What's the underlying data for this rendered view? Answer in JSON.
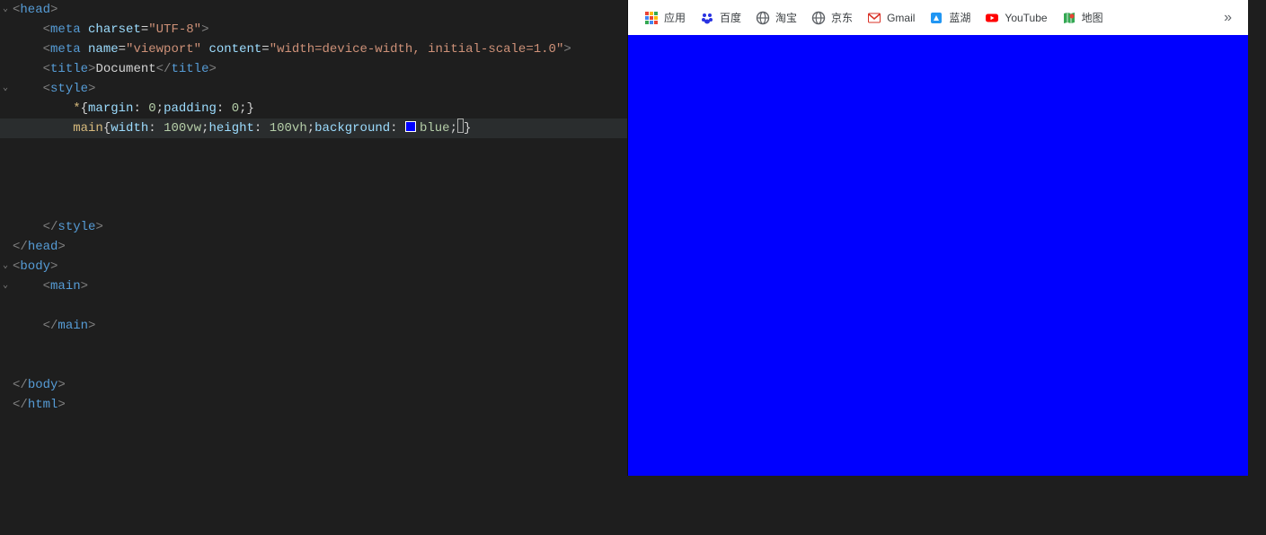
{
  "editor": {
    "lines": [
      {
        "indent": 0,
        "fold": true,
        "tokens": [
          {
            "c": "t-bracket",
            "t": "<"
          },
          {
            "c": "t-tag",
            "t": "head"
          },
          {
            "c": "t-bracket",
            "t": ">"
          }
        ]
      },
      {
        "indent": 1,
        "tokens": [
          {
            "c": "t-bracket",
            "t": "<"
          },
          {
            "c": "t-tag",
            "t": "meta"
          },
          {
            "c": "",
            "t": " "
          },
          {
            "c": "t-attr",
            "t": "charset"
          },
          {
            "c": "t-punc",
            "t": "="
          },
          {
            "c": "t-str",
            "t": "\"UTF-8\""
          },
          {
            "c": "t-bracket",
            "t": ">"
          }
        ]
      },
      {
        "indent": 1,
        "tokens": [
          {
            "c": "t-bracket",
            "t": "<"
          },
          {
            "c": "t-tag",
            "t": "meta"
          },
          {
            "c": "",
            "t": " "
          },
          {
            "c": "t-attr",
            "t": "name"
          },
          {
            "c": "t-punc",
            "t": "="
          },
          {
            "c": "t-str",
            "t": "\"viewport\""
          },
          {
            "c": "",
            "t": " "
          },
          {
            "c": "t-attr",
            "t": "content"
          },
          {
            "c": "t-punc",
            "t": "="
          },
          {
            "c": "t-str",
            "t": "\"width=device-width, initial-scale=1.0\""
          },
          {
            "c": "t-bracket",
            "t": ">"
          }
        ]
      },
      {
        "indent": 1,
        "tokens": [
          {
            "c": "t-bracket",
            "t": "<"
          },
          {
            "c": "t-tag",
            "t": "title"
          },
          {
            "c": "t-bracket",
            "t": ">"
          },
          {
            "c": "t-text",
            "t": "Document"
          },
          {
            "c": "t-bracket",
            "t": "</"
          },
          {
            "c": "t-tag",
            "t": "title"
          },
          {
            "c": "t-bracket",
            "t": ">"
          }
        ]
      },
      {
        "indent": 1,
        "fold": true,
        "tokens": [
          {
            "c": "t-bracket",
            "t": "<"
          },
          {
            "c": "t-tag",
            "t": "style"
          },
          {
            "c": "t-bracket",
            "t": ">"
          }
        ]
      },
      {
        "indent": 2,
        "tokens": [
          {
            "c": "t-sel",
            "t": "*"
          },
          {
            "c": "t-punc",
            "t": "{"
          },
          {
            "c": "t-prop",
            "t": "margin"
          },
          {
            "c": "t-punc",
            "t": ": "
          },
          {
            "c": "t-val",
            "t": "0"
          },
          {
            "c": "t-punc",
            "t": ";"
          },
          {
            "c": "t-prop",
            "t": "padding"
          },
          {
            "c": "t-punc",
            "t": ": "
          },
          {
            "c": "t-val",
            "t": "0"
          },
          {
            "c": "t-punc",
            "t": ";}"
          }
        ]
      },
      {
        "indent": 2,
        "hl": true,
        "tokens": [
          {
            "c": "t-sel",
            "t": "main"
          },
          {
            "c": "t-punc",
            "t": "{"
          },
          {
            "c": "t-prop",
            "t": "width"
          },
          {
            "c": "t-punc",
            "t": ": "
          },
          {
            "c": "t-val",
            "t": "100vw"
          },
          {
            "c": "t-punc",
            "t": ";"
          },
          {
            "c": "t-prop",
            "t": "height"
          },
          {
            "c": "t-punc",
            "t": ": "
          },
          {
            "c": "t-val",
            "t": "100vh"
          },
          {
            "c": "t-punc",
            "t": ";"
          },
          {
            "c": "t-prop",
            "t": "background"
          },
          {
            "c": "t-punc",
            "t": ": "
          },
          {
            "swatch": true
          },
          {
            "c": "t-val",
            "t": "blue"
          },
          {
            "c": "t-punc",
            "t": ";"
          },
          {
            "cursor": true
          },
          {
            "c": "t-punc",
            "t": "}"
          }
        ]
      },
      {
        "indent": 0,
        "tokens": []
      },
      {
        "indent": 0,
        "tokens": []
      },
      {
        "indent": 0,
        "tokens": []
      },
      {
        "indent": 0,
        "tokens": []
      },
      {
        "indent": 1,
        "tokens": [
          {
            "c": "t-bracket",
            "t": "</"
          },
          {
            "c": "t-tag",
            "t": "style"
          },
          {
            "c": "t-bracket",
            "t": ">"
          }
        ]
      },
      {
        "indent": 0,
        "tokens": [
          {
            "c": "t-bracket",
            "t": "</"
          },
          {
            "c": "t-tag",
            "t": "head"
          },
          {
            "c": "t-bracket",
            "t": ">"
          }
        ]
      },
      {
        "indent": 0,
        "fold": true,
        "tokens": [
          {
            "c": "t-bracket",
            "t": "<"
          },
          {
            "c": "t-tag",
            "t": "body"
          },
          {
            "c": "t-bracket",
            "t": ">"
          }
        ]
      },
      {
        "indent": 1,
        "fold": true,
        "tokens": [
          {
            "c": "t-bracket",
            "t": "<"
          },
          {
            "c": "t-tag",
            "t": "main"
          },
          {
            "c": "t-bracket",
            "t": ">"
          }
        ]
      },
      {
        "indent": 0,
        "tokens": []
      },
      {
        "indent": 1,
        "tokens": [
          {
            "c": "t-bracket",
            "t": "</"
          },
          {
            "c": "t-tag",
            "t": "main"
          },
          {
            "c": "t-bracket",
            "t": ">"
          }
        ]
      },
      {
        "indent": 0,
        "tokens": []
      },
      {
        "indent": 0,
        "tokens": []
      },
      {
        "indent": 0,
        "tokens": [
          {
            "c": "t-bracket",
            "t": "</"
          },
          {
            "c": "t-tag",
            "t": "body"
          },
          {
            "c": "t-bracket",
            "t": ">"
          }
        ]
      },
      {
        "indent": 0,
        "tokens": [
          {
            "c": "t-bracket",
            "t": "</"
          },
          {
            "c": "t-tag",
            "t": "html"
          },
          {
            "c": "t-bracket",
            "t": ">"
          }
        ]
      }
    ]
  },
  "bookmarks": {
    "apps": "应用",
    "items": [
      {
        "icon": "baidu",
        "label": "百度"
      },
      {
        "icon": "globe",
        "label": "淘宝"
      },
      {
        "icon": "globe",
        "label": "京东"
      },
      {
        "icon": "gmail",
        "label": "Gmail"
      },
      {
        "icon": "lanhu",
        "label": "蓝湖"
      },
      {
        "icon": "youtube",
        "label": "YouTube"
      },
      {
        "icon": "maps",
        "label": "地图"
      }
    ],
    "overflow": "»"
  },
  "preview": {
    "bg": "#0000ff"
  }
}
